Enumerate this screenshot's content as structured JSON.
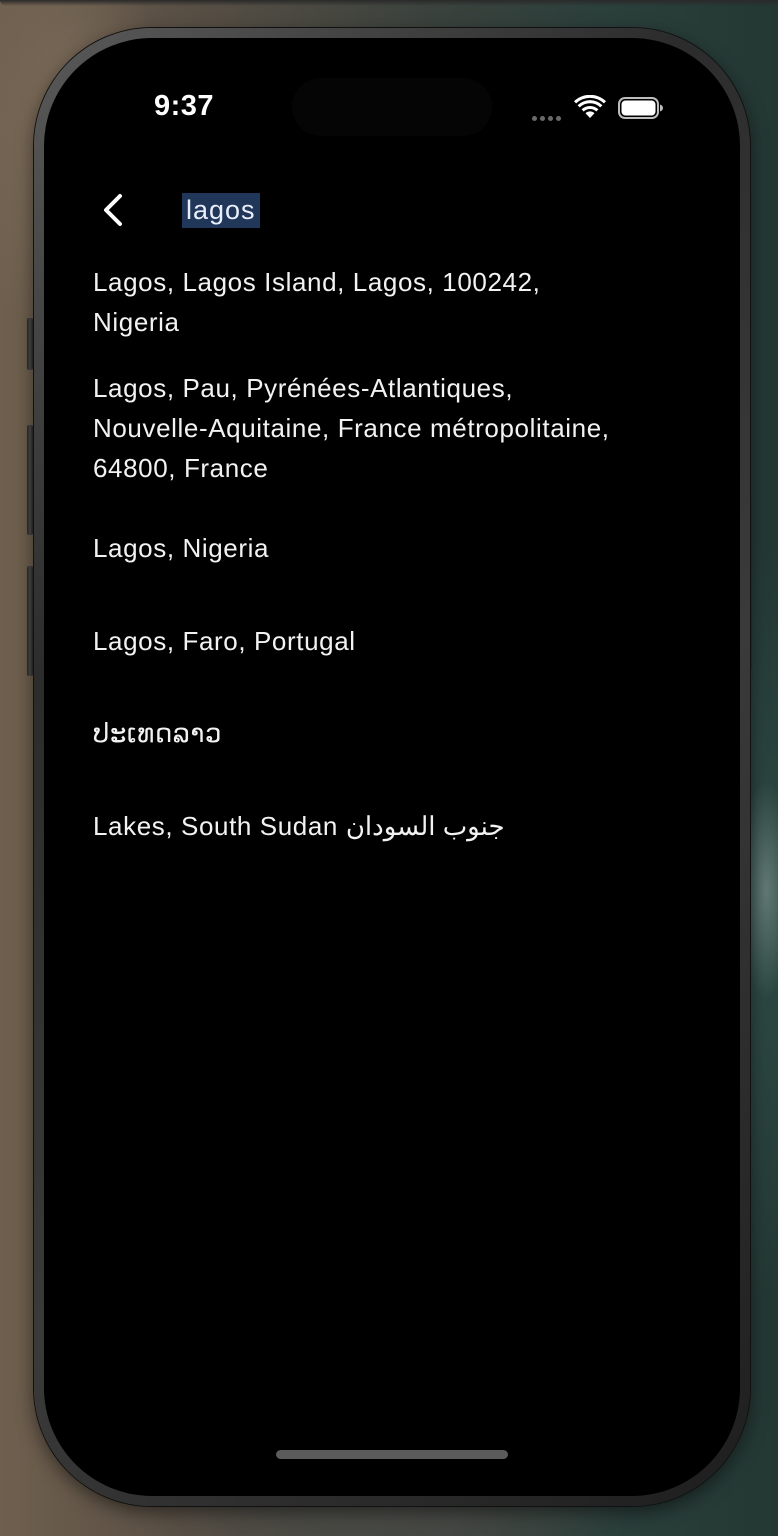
{
  "status_bar": {
    "time": "9:37"
  },
  "search": {
    "query": "lagos"
  },
  "results": [
    {
      "line1": "Lagos, Lagos Island, Lagos, 100242,",
      "line2": "Nigeria",
      "line3": ""
    },
    {
      "line1": "Lagos, Pau, Pyrénées-Atlantiques,",
      "line2": "Nouvelle-Aquitaine, France métropolitaine,",
      "line3": "64800, France"
    },
    {
      "line1": "Lagos, Nigeria",
      "line2": "",
      "line3": ""
    },
    {
      "line1": "Lagos, Faro, Portugal",
      "line2": "",
      "line3": ""
    },
    {
      "line1": "ປະເທດລາວ",
      "line2": "",
      "line3": ""
    },
    {
      "line1": "Lakes, South Sudan جنوب السودان",
      "line2": "",
      "line3": ""
    }
  ],
  "icons": {
    "back": "chevron-left-icon",
    "wifi": "wifi-icon",
    "battery": "battery-icon",
    "signal": "signal-dots-icon"
  },
  "colors": {
    "background": "#000000",
    "text": "#f2f2f2",
    "selection": "#21375a"
  }
}
